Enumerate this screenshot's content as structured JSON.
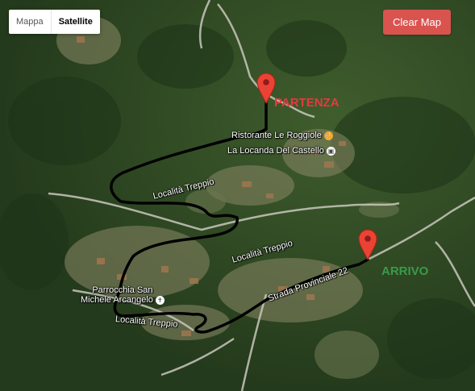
{
  "map_type": {
    "options": [
      "Mappa",
      "Satellite"
    ],
    "selected": "Satellite"
  },
  "clear_button": {
    "label": "Clear Map",
    "color": "#d9534f"
  },
  "markers": {
    "start": {
      "label": "PARTENZA",
      "color": "#e8383d"
    },
    "end": {
      "label": "ARRIVO",
      "color": "#3a9a48"
    }
  },
  "places": {
    "ristorante": "Ristorante Le Roggiole",
    "locanda": "La Locanda Del Castello",
    "parrocchia_line1": "Parrocchia San",
    "parrocchia_line2": "Michele Arcangelo",
    "poi_food_icon": "restaurant-icon",
    "poi_lodging_icon": "lodging-icon",
    "poi_church_icon": "church-icon"
  },
  "roads": {
    "treppio_upper": "Località Treppio",
    "treppio_middle": "Località Treppio",
    "treppio_lower": "Località Treppio",
    "provinciale": "Strada Provinciale 22"
  },
  "route_color": "#000000"
}
